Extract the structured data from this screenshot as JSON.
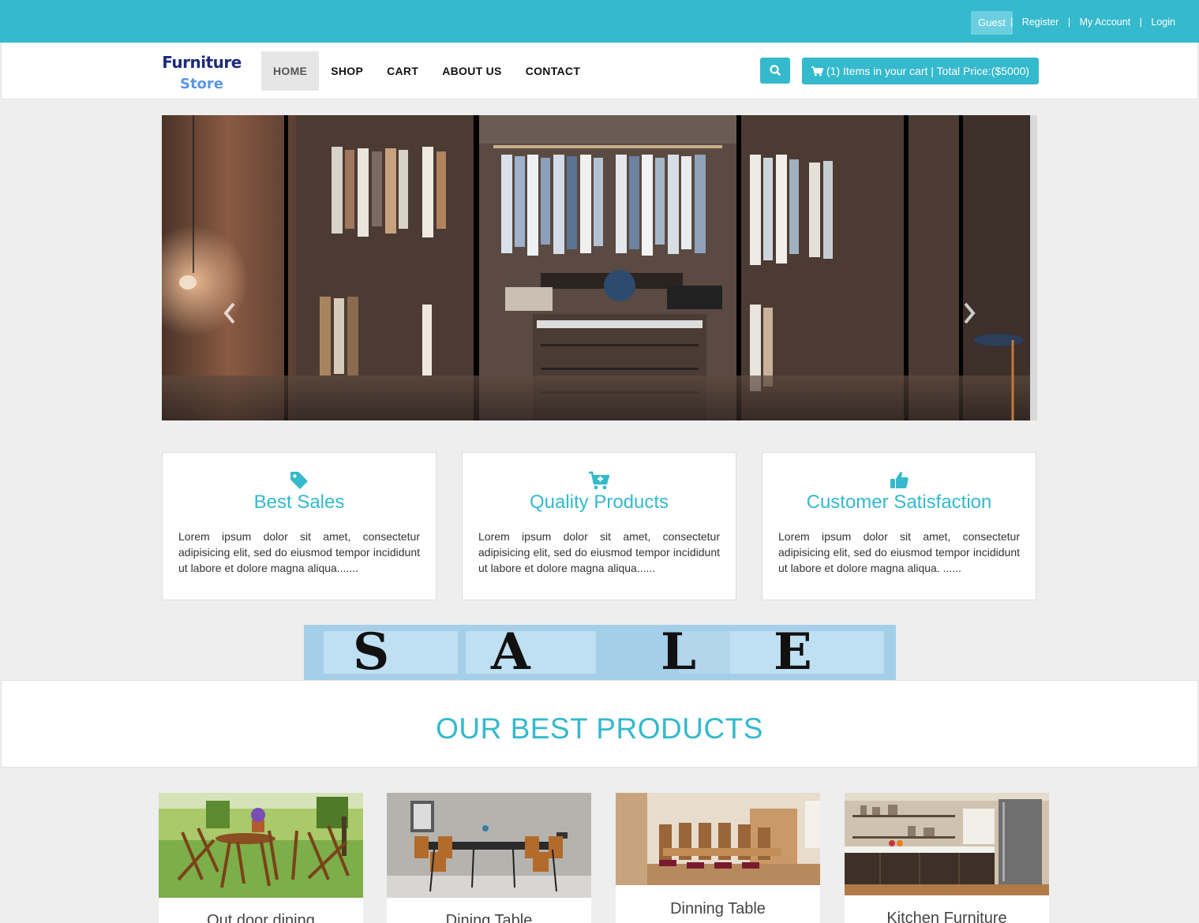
{
  "topbar": {
    "guest": "Guest",
    "links": [
      "Register",
      "My Account",
      "Login"
    ],
    "separator": "|"
  },
  "brand": {
    "line1": "Furniture",
    "line2": "Store"
  },
  "nav": {
    "items": [
      "HOME",
      "SHOP",
      "CART",
      "ABOUT US",
      "CONTACT"
    ],
    "active": "HOME"
  },
  "search": {
    "icon": "search-icon"
  },
  "cart": {
    "icon": "shopping-cart-icon",
    "label": "(1) Items in your cart | Total Price:($5000)"
  },
  "carousel": {
    "prev_icon": "chevron-left-icon",
    "next_icon": "chevron-right-icon"
  },
  "features": [
    {
      "icon": "tag-icon",
      "title": "Best Sales",
      "text": "Lorem ipsum dolor sit amet, consectetur adipisicing elit, sed do eiusmod tempor incididunt ut labore et dolore magna aliqua......."
    },
    {
      "icon": "cart-plus-icon",
      "title": "Quality Products",
      "text": "Lorem ipsum dolor sit amet, consectetur adipisicing elit, sed do eiusmod tempor incididunt ut labore et dolore magna aliqua......"
    },
    {
      "icon": "thumbs-up-icon",
      "title": "Customer Satisfaction",
      "text": "Lorem ipsum dolor sit amet, consectetur adipisicing elit, sed do eiusmod tempor incididunt ut labore et dolore magna aliqua. ......"
    }
  ],
  "sale_banner": {
    "letters": [
      "S",
      "A",
      "L",
      "E"
    ]
  },
  "best_products": {
    "heading": "OUR BEST PRODUCTS",
    "items": [
      "Out door dining",
      "Dining Table",
      "Dinning Table",
      "Kitchen Furniture"
    ]
  },
  "colors": {
    "accent": "#35b9cc",
    "page_bg": "#eeeeee",
    "brand_dark": "#1d2b7a",
    "brand_light": "#5a95e6"
  }
}
